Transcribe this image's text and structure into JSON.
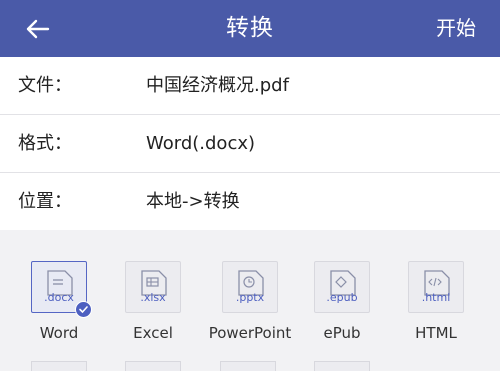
{
  "header": {
    "title": "转换",
    "start_label": "开始"
  },
  "rows": [
    {
      "label": "文件：",
      "value": "中国经济概况.pdf"
    },
    {
      "label": "格式：",
      "value": "Word(.docx)"
    },
    {
      "label": "位置：",
      "value": "本地->转换"
    }
  ],
  "formats": [
    {
      "ext": ".docx",
      "name": "Word",
      "selected": true,
      "icon": "doc-lines-icon"
    },
    {
      "ext": ".xlsx",
      "name": "Excel",
      "selected": false,
      "icon": "spreadsheet-icon"
    },
    {
      "ext": ".pptx",
      "name": "PowerPoint",
      "selected": false,
      "icon": "clock-icon"
    },
    {
      "ext": ".epub",
      "name": "ePub",
      "selected": false,
      "icon": "diamond-icon"
    },
    {
      "ext": ".html",
      "name": "HTML",
      "selected": false,
      "icon": "code-icon"
    }
  ],
  "colors": {
    "header_bg": "#4a5aa8",
    "accent": "#4d5fc0"
  }
}
